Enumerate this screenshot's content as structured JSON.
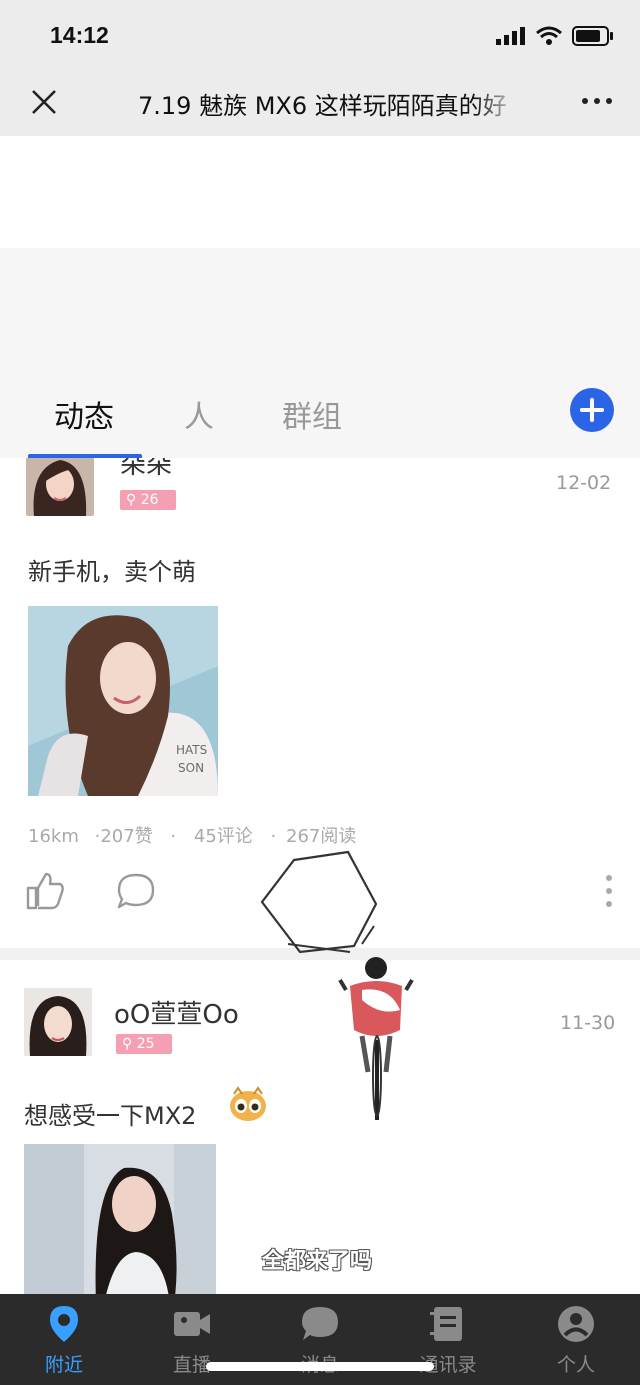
{
  "status_bar": {
    "time": "14:12"
  },
  "navbar": {
    "title": "7.19 魅族 MX6 这样玩陌陌真的好"
  },
  "tabs": [
    {
      "label": "动态",
      "active": true
    },
    {
      "label": "人",
      "active": false
    },
    {
      "label": "群组",
      "active": false
    }
  ],
  "posts": [
    {
      "username": "朵朵",
      "badge": "26",
      "date": "12-02",
      "text": "新手机，卖个萌",
      "distance": "16km",
      "likes": "·207赞",
      "comments": "45评论",
      "views": "267阅读",
      "sep": "·"
    },
    {
      "username": "oO萱萱Oo",
      "badge": "25",
      "date": "11-30",
      "text": "想感受一下MX2"
    }
  ],
  "caption": "全都来了吗",
  "bottom_tabs": [
    {
      "label": "附近",
      "icon": "location-pin-icon",
      "active": true
    },
    {
      "label": "直播",
      "icon": "video-camera-icon",
      "active": false
    },
    {
      "label": "消息",
      "icon": "chat-bubble-icon",
      "active": false
    },
    {
      "label": "通讯录",
      "icon": "contacts-book-icon",
      "active": false
    },
    {
      "label": "个人",
      "icon": "user-icon",
      "active": false
    }
  ],
  "colors": {
    "accent": "#2c64e8",
    "badge": "#f5a0b2",
    "tab_active": "#3aa0ff"
  }
}
